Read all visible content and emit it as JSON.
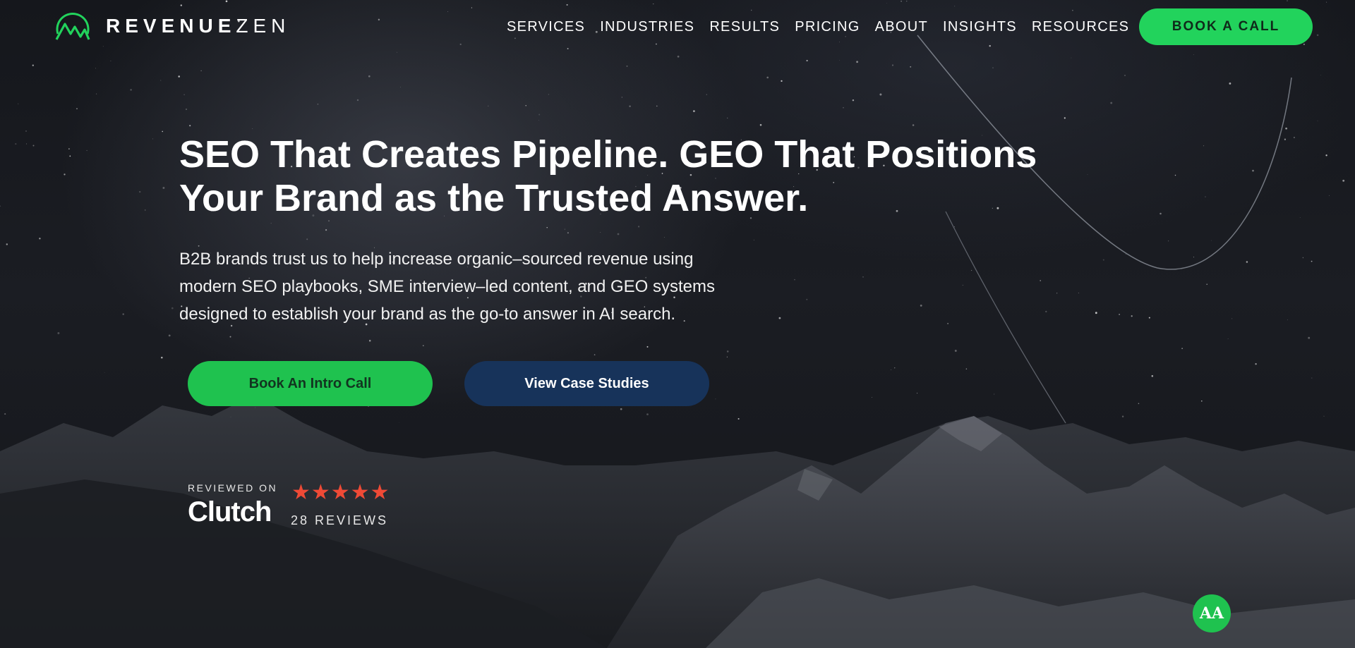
{
  "brand": {
    "name_bold": "REVENUE",
    "name_light": "ZEN",
    "logo_icon": "mountain-peaks-icon",
    "accent_color": "#22d35c"
  },
  "nav": {
    "items": [
      "SERVICES",
      "INDUSTRIES",
      "RESULTS",
      "PRICING",
      "ABOUT",
      "INSIGHTS",
      "RESOURCES"
    ],
    "cta_label": "BOOK A CALL"
  },
  "hero": {
    "title_lines": [
      "SEO That Creates Pipeline. GEO That Positions",
      "Your Brand as the Trusted Answer."
    ],
    "subtitle_lines": [
      "B2B brands trust us to help increase organic–sourced revenue using",
      "modern SEO playbooks, SME interview–led content, and GEO systems",
      "designed to establish your brand as the go-to answer in AI search."
    ],
    "primary_cta": "Book An Intro Call",
    "secondary_cta": "View Case Studies"
  },
  "clutch": {
    "reviewed_on": "REVIEWED ON",
    "logo_text": "Clutch",
    "rating_stars": 5,
    "stars_text": "★★★★★",
    "review_count": "28 REVIEWS"
  },
  "accessibility": {
    "label": "AA",
    "icon": "accessibility-icon"
  }
}
